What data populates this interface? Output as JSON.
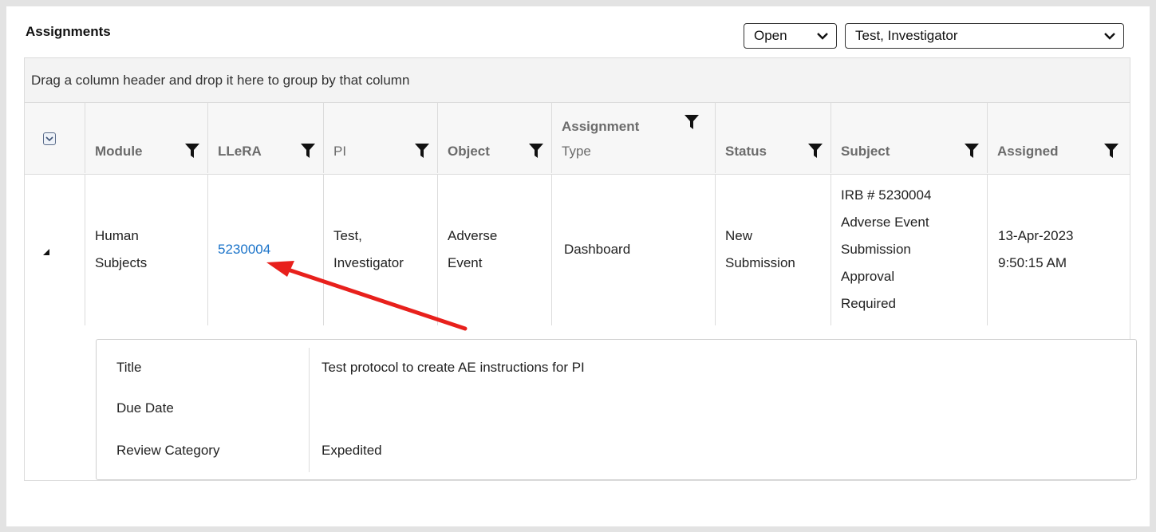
{
  "panel": {
    "title": "Assignments",
    "status_filter": {
      "selected": "Open"
    },
    "user_filter": {
      "selected": "Test, Investigator"
    }
  },
  "grid": {
    "group_hint": "Drag a column header and drop it here to group by that column",
    "columns": {
      "module": "Module",
      "llera": "LLeRA",
      "pi": "PI",
      "object": "Object",
      "assignment_type_1": "Assignment",
      "assignment_type_2": "Type",
      "status": "Status",
      "subject": "Subject",
      "assigned": "Assigned"
    },
    "rows": [
      {
        "module_1": "Human",
        "module_2": "Subjects",
        "llera": "5230004",
        "pi_1": "Test,",
        "pi_2": "Investigator",
        "object_1": "Adverse",
        "object_2": "Event",
        "assignment_type": "Dashboard",
        "status_1": "New",
        "status_2": "Submission",
        "subject_1": "IRB # 5230004",
        "subject_2": "Adverse Event",
        "subject_3": "Submission",
        "subject_4": "Approval",
        "subject_5": "Required",
        "assigned_1": "13-Apr-2023",
        "assigned_2": "9:50:15 AM"
      }
    ],
    "detail": {
      "title_label": "Title",
      "title_value": "Test protocol to create AE instructions for PI",
      "due_label": "Due Date",
      "due_value": "",
      "review_label": "Review Category",
      "review_value": "Expedited"
    }
  },
  "annotation": {
    "color": "#e8201c"
  },
  "icons": {
    "filter": "filter-icon",
    "chevron": "chevron-down-icon",
    "expand": "expand-all-icon",
    "row_caret": "collapse-caret-icon"
  }
}
